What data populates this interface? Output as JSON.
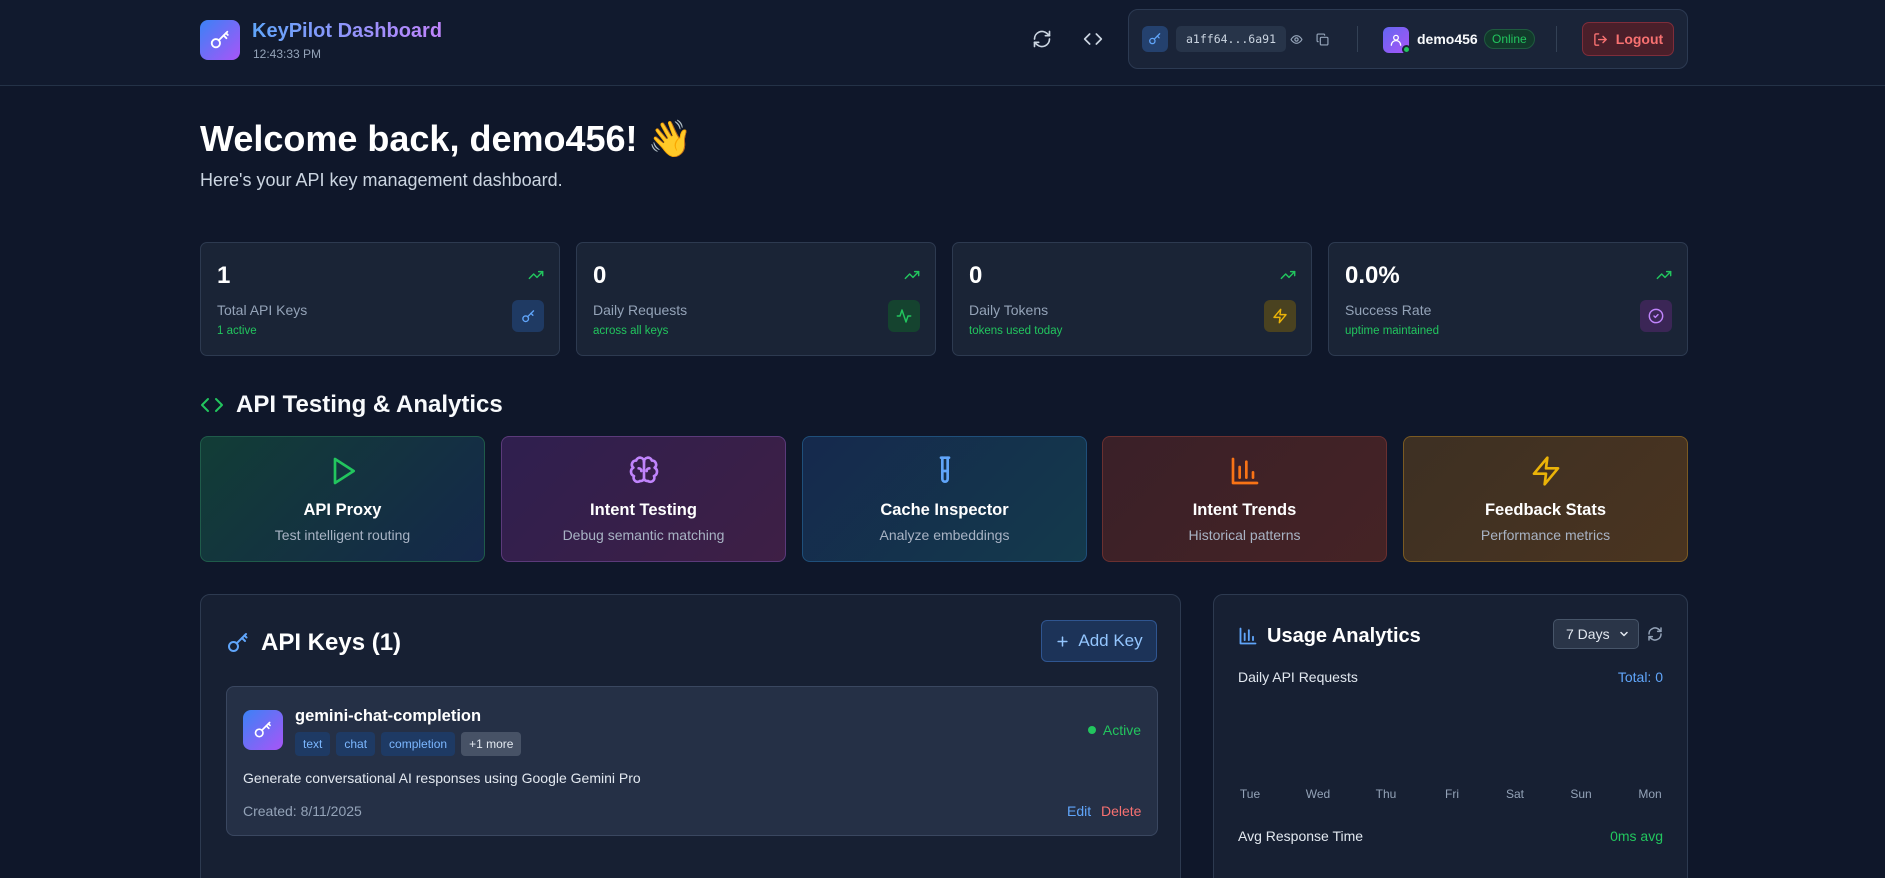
{
  "header": {
    "title": "KeyPilot Dashboard",
    "time": "12:43:33 PM",
    "api_key_masked": "a1ff64...6a91",
    "user_name": "demo456",
    "online_status": "Online",
    "logout_label": "Logout"
  },
  "welcome": {
    "title": "Welcome back, demo456! 👋",
    "subtitle": "Here's your API key management dashboard."
  },
  "stats": [
    {
      "value": "1",
      "label": "Total API Keys",
      "sub": "1 active",
      "icon": "key-icon",
      "color": "#60a5fa"
    },
    {
      "value": "0",
      "label": "Daily Requests",
      "sub": "across all keys",
      "icon": "activity-icon",
      "color": "#22c55e"
    },
    {
      "value": "0",
      "label": "Daily Tokens",
      "sub": "tokens used today",
      "icon": "zap-icon",
      "color": "#eab308"
    },
    {
      "value": "0.0%",
      "label": "Success Rate",
      "sub": "uptime maintained",
      "icon": "check-circle-icon",
      "color": "#a855f7"
    }
  ],
  "testing": {
    "title": "API Testing & Analytics",
    "tools": [
      {
        "name": "API Proxy",
        "desc": "Test intelligent routing",
        "icon": "play-icon",
        "color": "#22c55e"
      },
      {
        "name": "Intent Testing",
        "desc": "Debug semantic matching",
        "icon": "brain-icon",
        "color": "#c084fc"
      },
      {
        "name": "Cache Inspector",
        "desc": "Analyze embeddings",
        "icon": "test-tube-icon",
        "color": "#60a5fa"
      },
      {
        "name": "Intent Trends",
        "desc": "Historical patterns",
        "icon": "bar-chart-icon",
        "color": "#f97316"
      },
      {
        "name": "Feedback Stats",
        "desc": "Performance metrics",
        "icon": "zap-icon",
        "color": "#eab308"
      }
    ]
  },
  "api_keys": {
    "title": "API Keys (1)",
    "add_label": "Add Key",
    "items": [
      {
        "name": "gemini-chat-completion",
        "tags": [
          "text",
          "chat",
          "completion",
          "+1 more"
        ],
        "status": "Active",
        "description": "Generate conversational AI responses using Google Gemini Pro",
        "created": "Created: 8/11/2025",
        "edit_label": "Edit",
        "delete_label": "Delete"
      }
    ]
  },
  "usage": {
    "title": "Usage Analytics",
    "range": "7 Days",
    "daily_label": "Daily API Requests",
    "total_label": "Total: 0",
    "days": [
      "Tue",
      "Wed",
      "Thu",
      "Fri",
      "Sat",
      "Sun",
      "Mon"
    ],
    "avg_label": "Avg Response Time",
    "avg_value": "0ms avg"
  }
}
